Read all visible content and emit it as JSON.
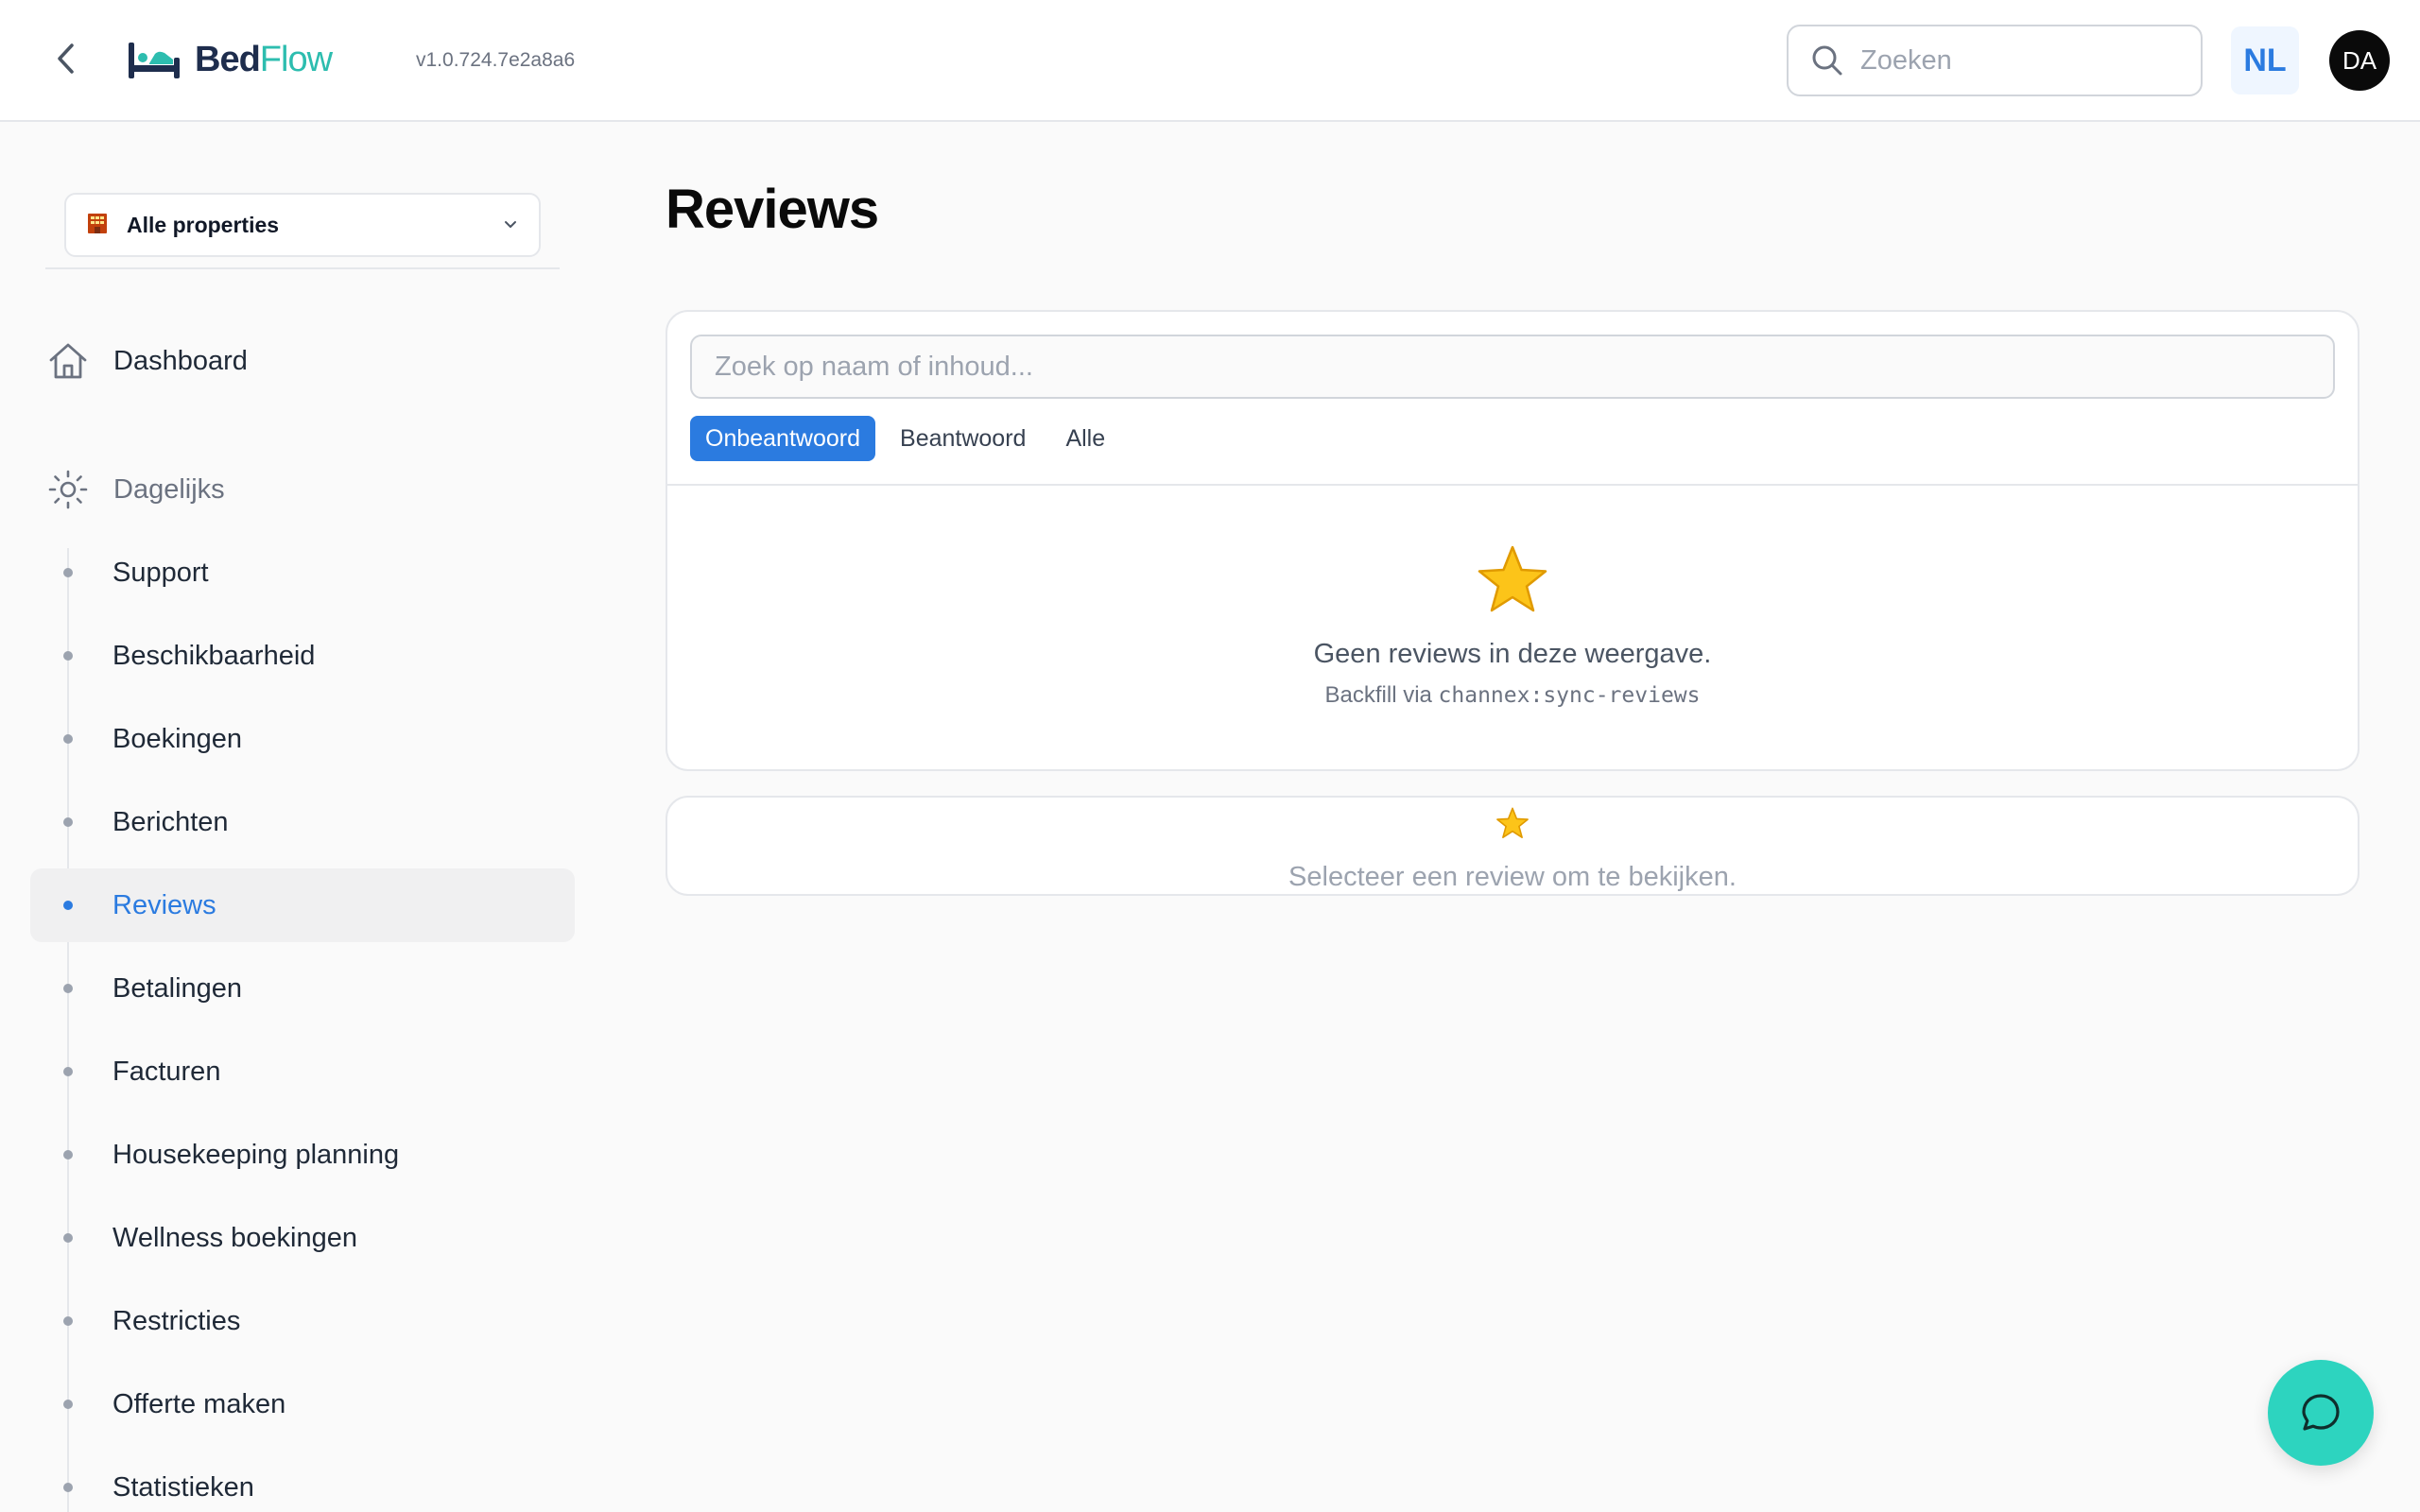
{
  "header": {
    "back_icon": "chevron-left-icon",
    "logo": {
      "part1": "Bed",
      "part2": "Flow",
      "icon": "bed-icon"
    },
    "version": "v1.0.724.7e2a8a6",
    "search": {
      "placeholder": "Zoeken",
      "icon": "search-icon"
    },
    "language": "NL",
    "user_initials": "DA"
  },
  "sidebar": {
    "property_selector": {
      "icon": "hotel-icon",
      "label": "Alle properties"
    },
    "dashboard": {
      "label": "Dashboard",
      "icon": "home-icon"
    },
    "group": {
      "label": "Dagelijks",
      "icon": "sun-icon"
    },
    "items": [
      {
        "label": "Support",
        "active": false
      },
      {
        "label": "Beschikbaarheid",
        "active": false
      },
      {
        "label": "Boekingen",
        "active": false
      },
      {
        "label": "Berichten",
        "active": false
      },
      {
        "label": "Reviews",
        "active": true
      },
      {
        "label": "Betalingen",
        "active": false
      },
      {
        "label": "Facturen",
        "active": false
      },
      {
        "label": "Housekeeping planning",
        "active": false
      },
      {
        "label": "Wellness boekingen",
        "active": false
      },
      {
        "label": "Restricties",
        "active": false
      },
      {
        "label": "Offerte maken",
        "active": false
      },
      {
        "label": "Statistieken",
        "active": false
      }
    ]
  },
  "main": {
    "title": "Reviews",
    "search_placeholder": "Zoek op naam of inhoud...",
    "tabs": [
      {
        "label": "Onbeantwoord",
        "active": true
      },
      {
        "label": "Beantwoord",
        "active": false
      },
      {
        "label": "Alle",
        "active": false
      }
    ],
    "empty_state": {
      "icon": "star-icon",
      "title": "Geen reviews in deze weergave.",
      "sub_prefix": "Backfill via",
      "sub_code": "channex:sync-reviews"
    },
    "detail_placeholder": {
      "icon": "star-icon",
      "text": "Selecteer een review om te bekijken."
    }
  },
  "chat_button": {
    "icon": "chat-bubble-icon"
  },
  "colors": {
    "accent": "#2b7be0",
    "brand_teal": "#2dd4bf",
    "logo_navy": "#1e2d4d",
    "star": "#f5b800"
  }
}
